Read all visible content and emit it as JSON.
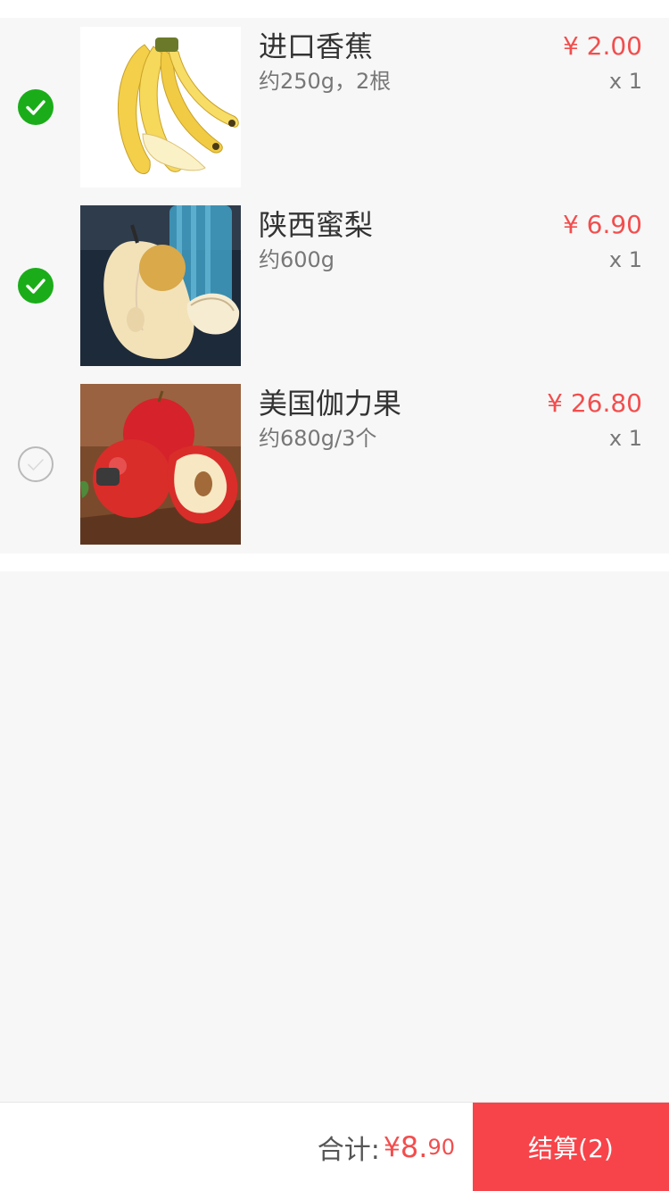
{
  "cart": {
    "items": [
      {
        "name": "进口香蕉",
        "spec": "约250g，2根",
        "price": "¥ 2.00",
        "qty": "x 1",
        "checked": true,
        "image": "banana-image"
      },
      {
        "name": "陕西蜜梨",
        "spec": "约600g",
        "price": "¥ 6.90",
        "qty": "x 1",
        "checked": true,
        "image": "pear-image"
      },
      {
        "name": "美国伽力果",
        "spec": "约680g/3个",
        "price": "¥ 26.80",
        "qty": "x 1",
        "checked": false,
        "image": "apple-image"
      }
    ]
  },
  "footer": {
    "total_label": "合计:",
    "total_currency": "¥",
    "total_integer": "8.",
    "total_decimal": "90",
    "checkout_label": "结算(2)"
  },
  "icons": {
    "checked": "check-circle-icon",
    "unchecked": "empty-circle-icon"
  },
  "colors": {
    "accent": "#f24e4e",
    "checkout_bg": "#f7444a",
    "check_green": "#1aad19",
    "page_bg": "#f7f7f7"
  }
}
